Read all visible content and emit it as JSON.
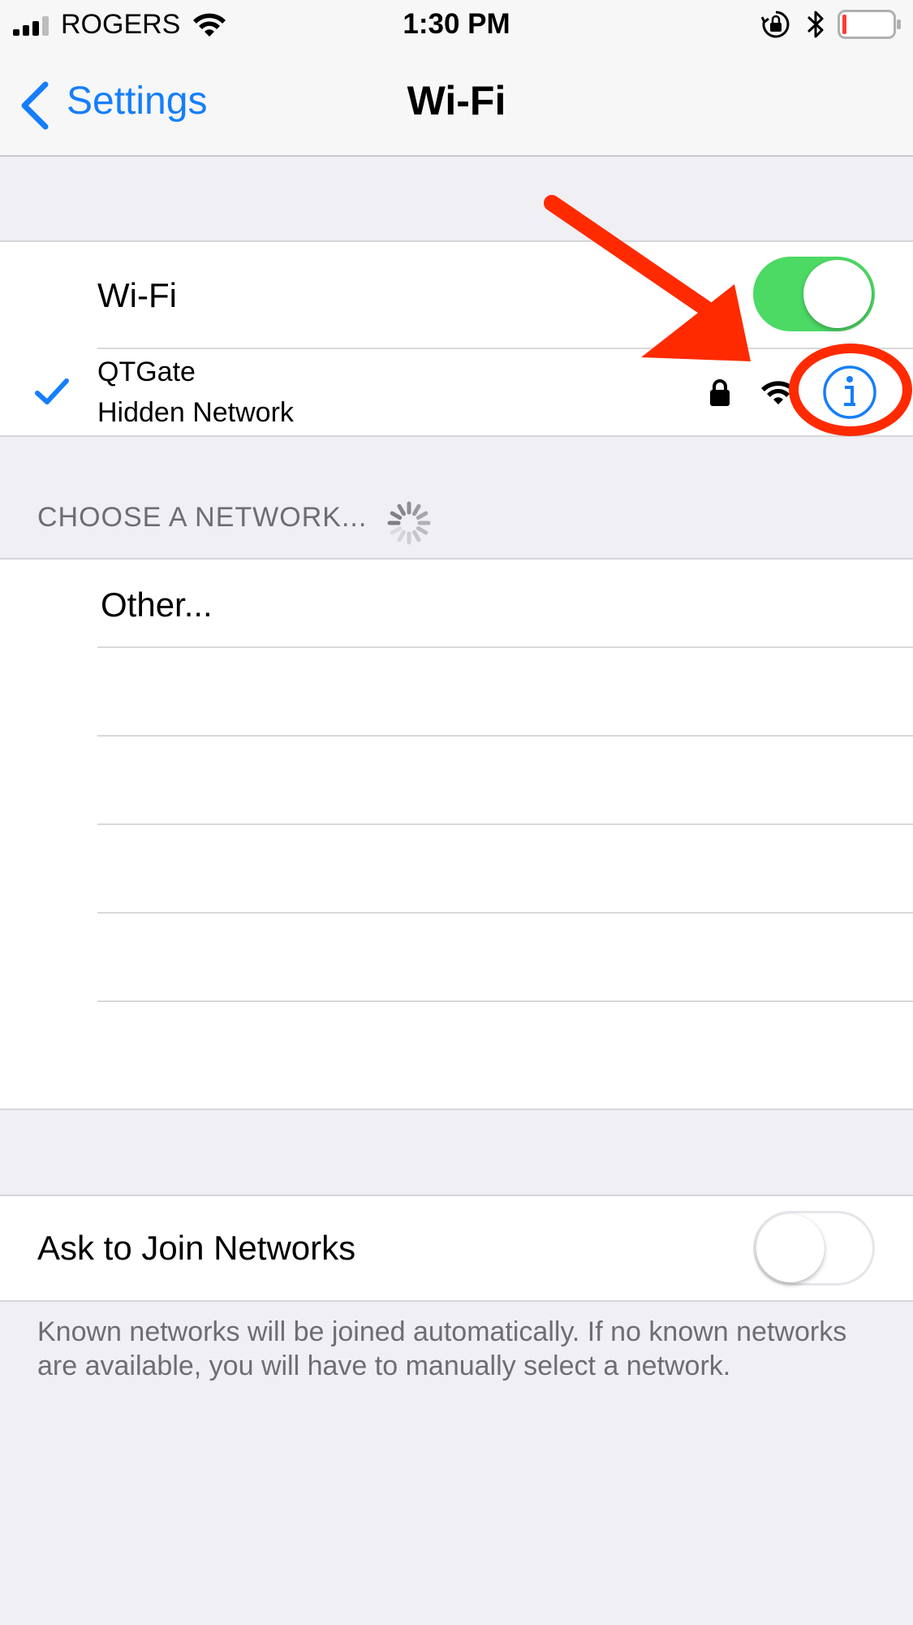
{
  "status_bar": {
    "carrier": "ROGERS",
    "time": "1:30 PM",
    "battery_color": "#ff3b30"
  },
  "nav": {
    "back_label": "Settings",
    "title": "Wi-Fi"
  },
  "wifi": {
    "label": "Wi-Fi",
    "enabled": true,
    "connected_network": {
      "name": "QTGate",
      "subtitle": "Hidden Network",
      "secured": true
    }
  },
  "choose_network": {
    "header": "CHOOSE A NETWORK...",
    "other_label": "Other..."
  },
  "ask_to_join": {
    "label": "Ask to Join Networks",
    "enabled": false,
    "footer": "Known networks will be joined automatically. If no known networks are available, you will have to manually select a network."
  },
  "colors": {
    "accent": "#157efb",
    "toggle_on": "#4cd964",
    "annotation": "#ff2a00"
  }
}
